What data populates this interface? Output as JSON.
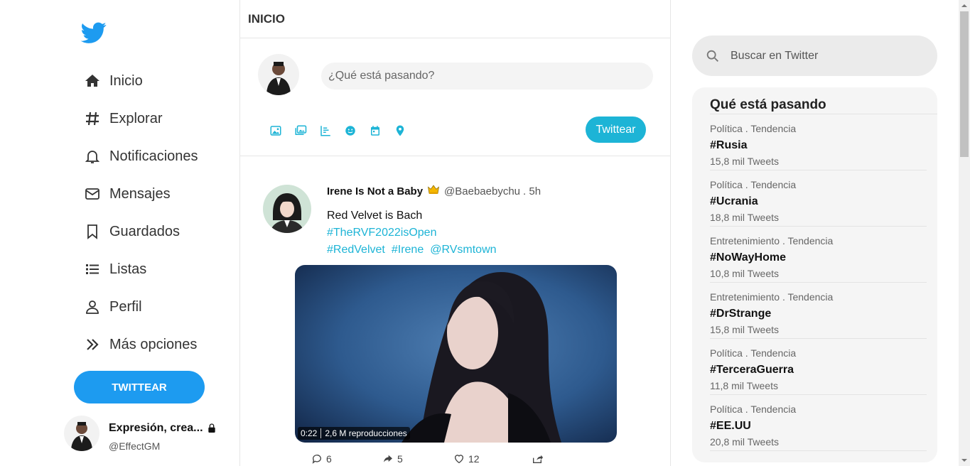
{
  "colors": {
    "accent": "#1d9bf0",
    "accent_teal": "#1db4d6"
  },
  "sidebar": {
    "logo": "twitter-bird-icon",
    "items": [
      {
        "label": "Inicio",
        "icon": "home-icon"
      },
      {
        "label": "Explorar",
        "icon": "hashtag-icon"
      },
      {
        "label": "Notificaciones",
        "icon": "bell-icon"
      },
      {
        "label": "Mensajes",
        "icon": "envelope-icon"
      },
      {
        "label": "Guardados",
        "icon": "bookmark-icon"
      },
      {
        "label": "Listas",
        "icon": "list-icon"
      },
      {
        "label": "Perfil",
        "icon": "user-icon"
      },
      {
        "label": "Más opciones",
        "icon": "double-chevron-icon"
      }
    ],
    "tweet_button": "TWITTEAR",
    "account": {
      "name": "Expresión, crea...",
      "handle": "@EffectGM"
    }
  },
  "main": {
    "title": "INICIO",
    "composer": {
      "placeholder": "¿Qué está pasando?",
      "tools": [
        "image-icon",
        "gallery-icon",
        "poll-icon",
        "emoji-icon",
        "calendar-icon",
        "location-icon"
      ],
      "button": "Twittear"
    },
    "tweet": {
      "name": "Irene Is Not a Baby",
      "badge": "crown-icon",
      "handle": "@Baebaebychu",
      "time": ". 5h",
      "text": "Red Velvet is Bach",
      "hashtags_line1": "#TheRVF2022isOpen",
      "hashtags_line2": [
        "#RedVelvet",
        "#Irene",
        "@RVsmtown"
      ],
      "media": {
        "duration": "0:22",
        "views": "2,6 M reproducciones"
      },
      "actions": {
        "replies": "6",
        "retweets": "5",
        "likes": "12"
      }
    }
  },
  "right": {
    "search_placeholder": "Buscar en Twitter",
    "trends_title": "Qué está pasando",
    "trends": [
      {
        "category": "Política . Tendencia",
        "tag": "#Rusia",
        "count": "15,8 mil Tweets"
      },
      {
        "category": "Política . Tendencia",
        "tag": "#Ucrania",
        "count": "18,8 mil Tweets"
      },
      {
        "category": "Entretenimiento . Tendencia",
        "tag": "#NoWayHome",
        "count": "10,8 mil Tweets"
      },
      {
        "category": "Entretenimiento . Tendencia",
        "tag": "#DrStrange",
        "count": "15,8 mil Tweets"
      },
      {
        "category": "Política . Tendencia",
        "tag": "#TerceraGuerra",
        "count": "11,8 mil Tweets"
      },
      {
        "category": "Política . Tendencia",
        "tag": "#EE.UU",
        "count": "20,8 mil Tweets"
      }
    ]
  }
}
